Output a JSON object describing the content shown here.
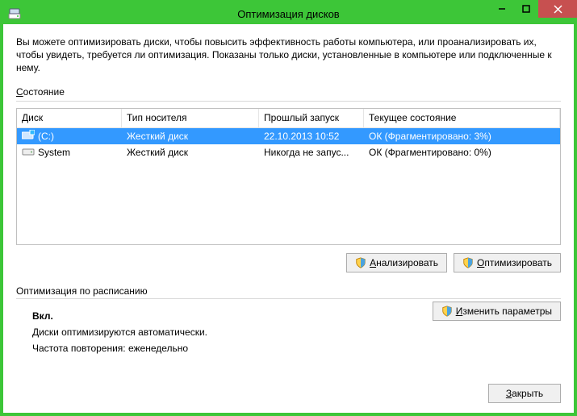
{
  "title": "Оптимизация дисков",
  "description": "Вы можете оптимизировать диски, чтобы повысить эффективность работы  компьютера, или проанализировать их, чтобы увидеть, требуется ли оптимизация. Показаны только диски, установленные в компьютере или подключенные к нему.",
  "state_label_first": "С",
  "state_label_rest": "остояние",
  "columns": {
    "disk": "Диск",
    "media": "Тип носителя",
    "lastrun": "Прошлый запуск",
    "current": "Текущее состояние"
  },
  "rows": [
    {
      "name": "(C:)",
      "media": "Жесткий диск",
      "last": "22.10.2013 10:52",
      "state": "ОК (Фрагментировано: 3%)",
      "selected": true,
      "icon": "drive-c"
    },
    {
      "name": "System",
      "media": "Жесткий диск",
      "last": "Никогда не запус...",
      "state": "ОК (Фрагментировано: 0%)",
      "selected": false,
      "icon": "drive"
    }
  ],
  "buttons": {
    "analyze_u": "А",
    "analyze_rest": "нализировать",
    "optimize_u": "О",
    "optimize_rest": "птимизировать",
    "change_u": "И",
    "change_rest": "зменить параметры",
    "close_u": "З",
    "close_rest": "акрыть"
  },
  "schedule": {
    "heading": "Оптимизация по расписанию",
    "on": "Вкл.",
    "auto": "Диски оптимизируются автоматически.",
    "freq": "Частота повторения: еженедельно"
  }
}
